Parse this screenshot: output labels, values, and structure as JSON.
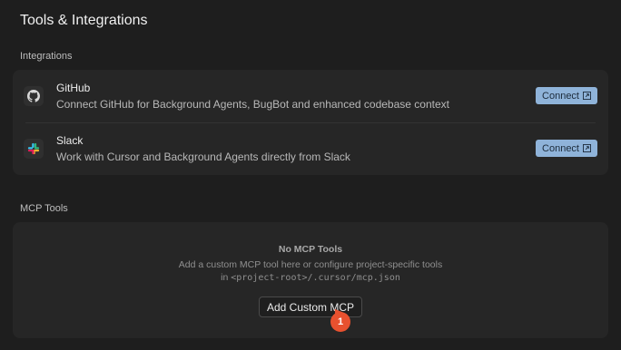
{
  "page": {
    "title": "Tools & Integrations"
  },
  "integrations": {
    "section_label": "Integrations",
    "items": [
      {
        "name": "GitHub",
        "description": "Connect GitHub for Background Agents, BugBot and enhanced codebase context",
        "icon": "github-icon",
        "button_label": "Connect"
      },
      {
        "name": "Slack",
        "description": "Work with Cursor and Background Agents directly from Slack",
        "icon": "slack-icon",
        "button_label": "Connect"
      }
    ]
  },
  "mcp": {
    "section_label": "MCP Tools",
    "empty_title": "No MCP Tools",
    "empty_desc_line1": "Add a custom MCP tool here or configure project-specific tools",
    "empty_desc_prefix": "in ",
    "empty_desc_path": "<project-root>/.cursor/mcp.json",
    "add_button_label": "Add Custom MCP"
  },
  "annotation": {
    "marker_label": "1"
  },
  "colors": {
    "background": "#1e1e1e",
    "card": "#262626",
    "connect_button": "#8fb3d9",
    "marker": "#e8512f"
  }
}
